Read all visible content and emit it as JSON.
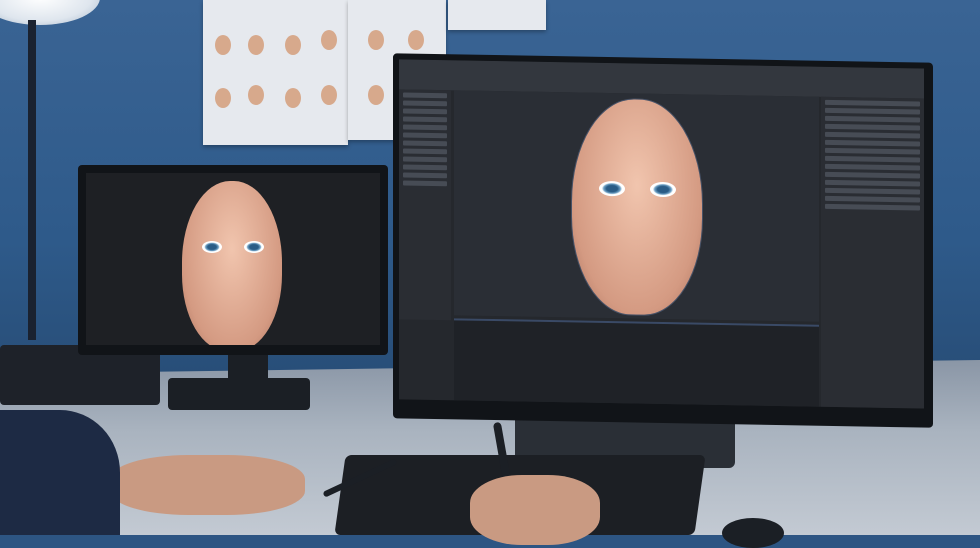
{
  "scene": {
    "description_colors": {
      "wall": "#2e5a8a",
      "desk": "#a9b3bf",
      "screen_bg": "#1f2226"
    }
  }
}
